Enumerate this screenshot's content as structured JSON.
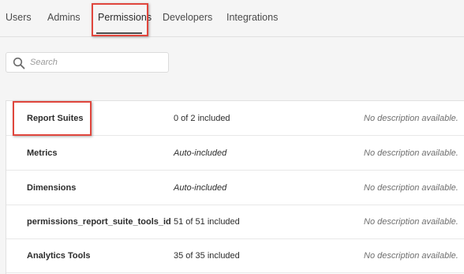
{
  "tabs": [
    {
      "label": "Users"
    },
    {
      "label": "Admins"
    },
    {
      "label": "Permissions"
    },
    {
      "label": "Developers"
    },
    {
      "label": "Integrations"
    }
  ],
  "active_tab": "Permissions",
  "search": {
    "placeholder": "Search",
    "value": ""
  },
  "rows": [
    {
      "name": "Report Suites",
      "status": "0 of 2 included",
      "status_style": "normal",
      "description": "No description available."
    },
    {
      "name": "Metrics",
      "status": "Auto-included",
      "status_style": "italic",
      "description": "No description available."
    },
    {
      "name": "Dimensions",
      "status": "Auto-included",
      "status_style": "italic",
      "description": "No description available."
    },
    {
      "name": "permissions_report_suite_tools_id",
      "status": "51 of 51 included",
      "status_style": "normal",
      "description": "No description available."
    },
    {
      "name": "Analytics Tools",
      "status": "35 of 35 included",
      "status_style": "normal",
      "description": "No description available."
    }
  ],
  "colors": {
    "highlight": "#e0463d",
    "background": "#f5f5f5",
    "panel": "#ffffff",
    "text": "#2c2c2c",
    "muted": "#6e6e6e"
  },
  "icons": {
    "search": "search-icon"
  }
}
